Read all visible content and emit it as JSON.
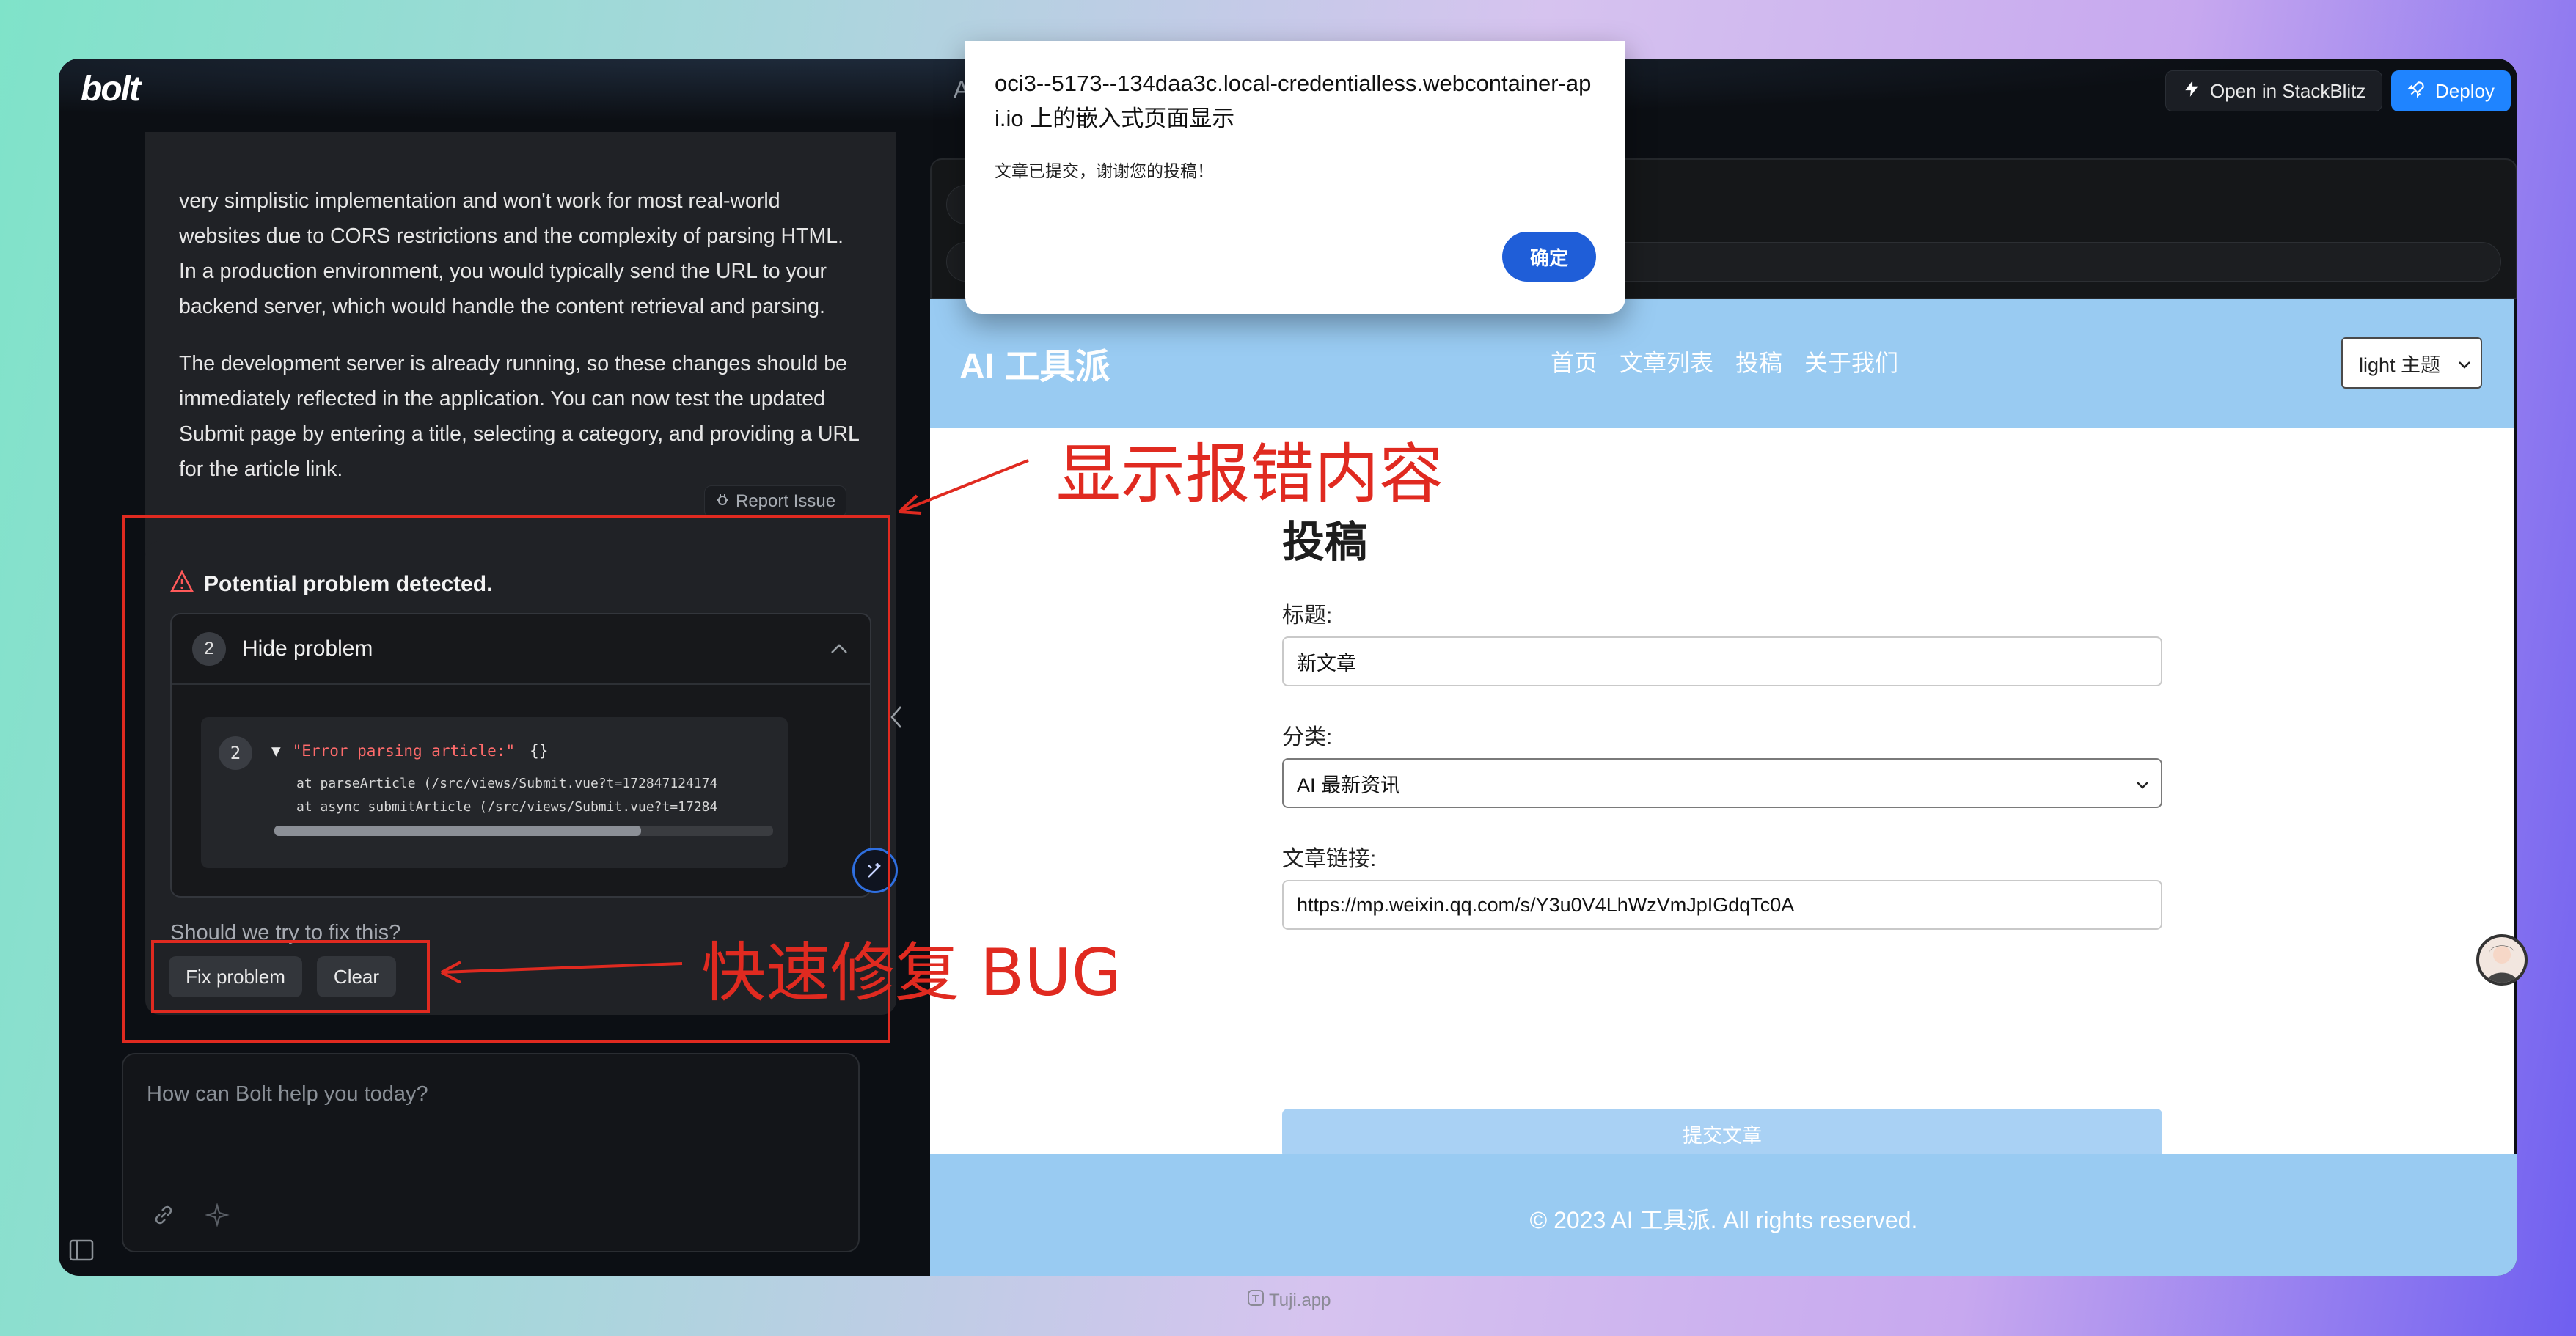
{
  "app": {
    "logo": "bolt",
    "topbar_partial": "A"
  },
  "toolbar": {
    "open_stackblitz": "Open in StackBlitz",
    "deploy": "Deploy"
  },
  "chat": {
    "paragraph1": "very simplistic implementation and won't work for most real-world websites due to CORS restrictions and the complexity of parsing HTML. In a production environment, you would typically send the URL to your backend server, which would handle the content retrieval and parsing.",
    "paragraph2": "The development server is already running, so these changes should be immediately reflected in the application. You can now test the updated Submit page by entering a title, selecting a category, and providing a URL for the article link.",
    "report_issue": "Report Issue"
  },
  "problem": {
    "title": "Potential problem detected.",
    "count": "2",
    "toggle_label": "Hide problem",
    "console_count": "2",
    "error_text": "\"Error parsing article:\"",
    "error_obj": "{}",
    "trace1": "at parseArticle (/src/views/Submit.vue?t=172847124174",
    "trace2": "at async submitArticle (/src/views/Submit.vue?t=17284",
    "fix_question": "Should we try to fix this?",
    "fix_button": "Fix problem",
    "clear_button": "Clear"
  },
  "prompt": {
    "placeholder": "How can Bolt help you today?"
  },
  "dialog": {
    "title": "oci3--5173--134daa3c.local-credentialless.webcontainer-api.io 上的嵌入式页面显示",
    "message": "文章已提交，谢谢您的投稿！",
    "ok": "确定"
  },
  "site": {
    "logo": "AI 工具派",
    "nav": [
      "首页",
      "文章列表",
      "投稿",
      "关于我们"
    ],
    "theme": "light 主题",
    "form_title": "投稿",
    "title_label": "标题:",
    "title_value": "新文章",
    "category_label": "分类:",
    "category_value": "AI 最新资讯",
    "link_label": "文章链接:",
    "link_value": "https://mp.weixin.qq.com/s/Y3u0V4LhWzVmJpIGdqTc0A",
    "submit": "提交文章",
    "footer": "© 2023 AI 工具派. All rights reserved."
  },
  "annotations": {
    "error_note": "显示报错内容",
    "fix_note": "快速修复 BUG"
  },
  "watermark": "Tuji.app",
  "colors": {
    "accent_red": "#e02a20",
    "deploy_blue": "#1f84ff",
    "header_blue": "#99cbf2"
  }
}
